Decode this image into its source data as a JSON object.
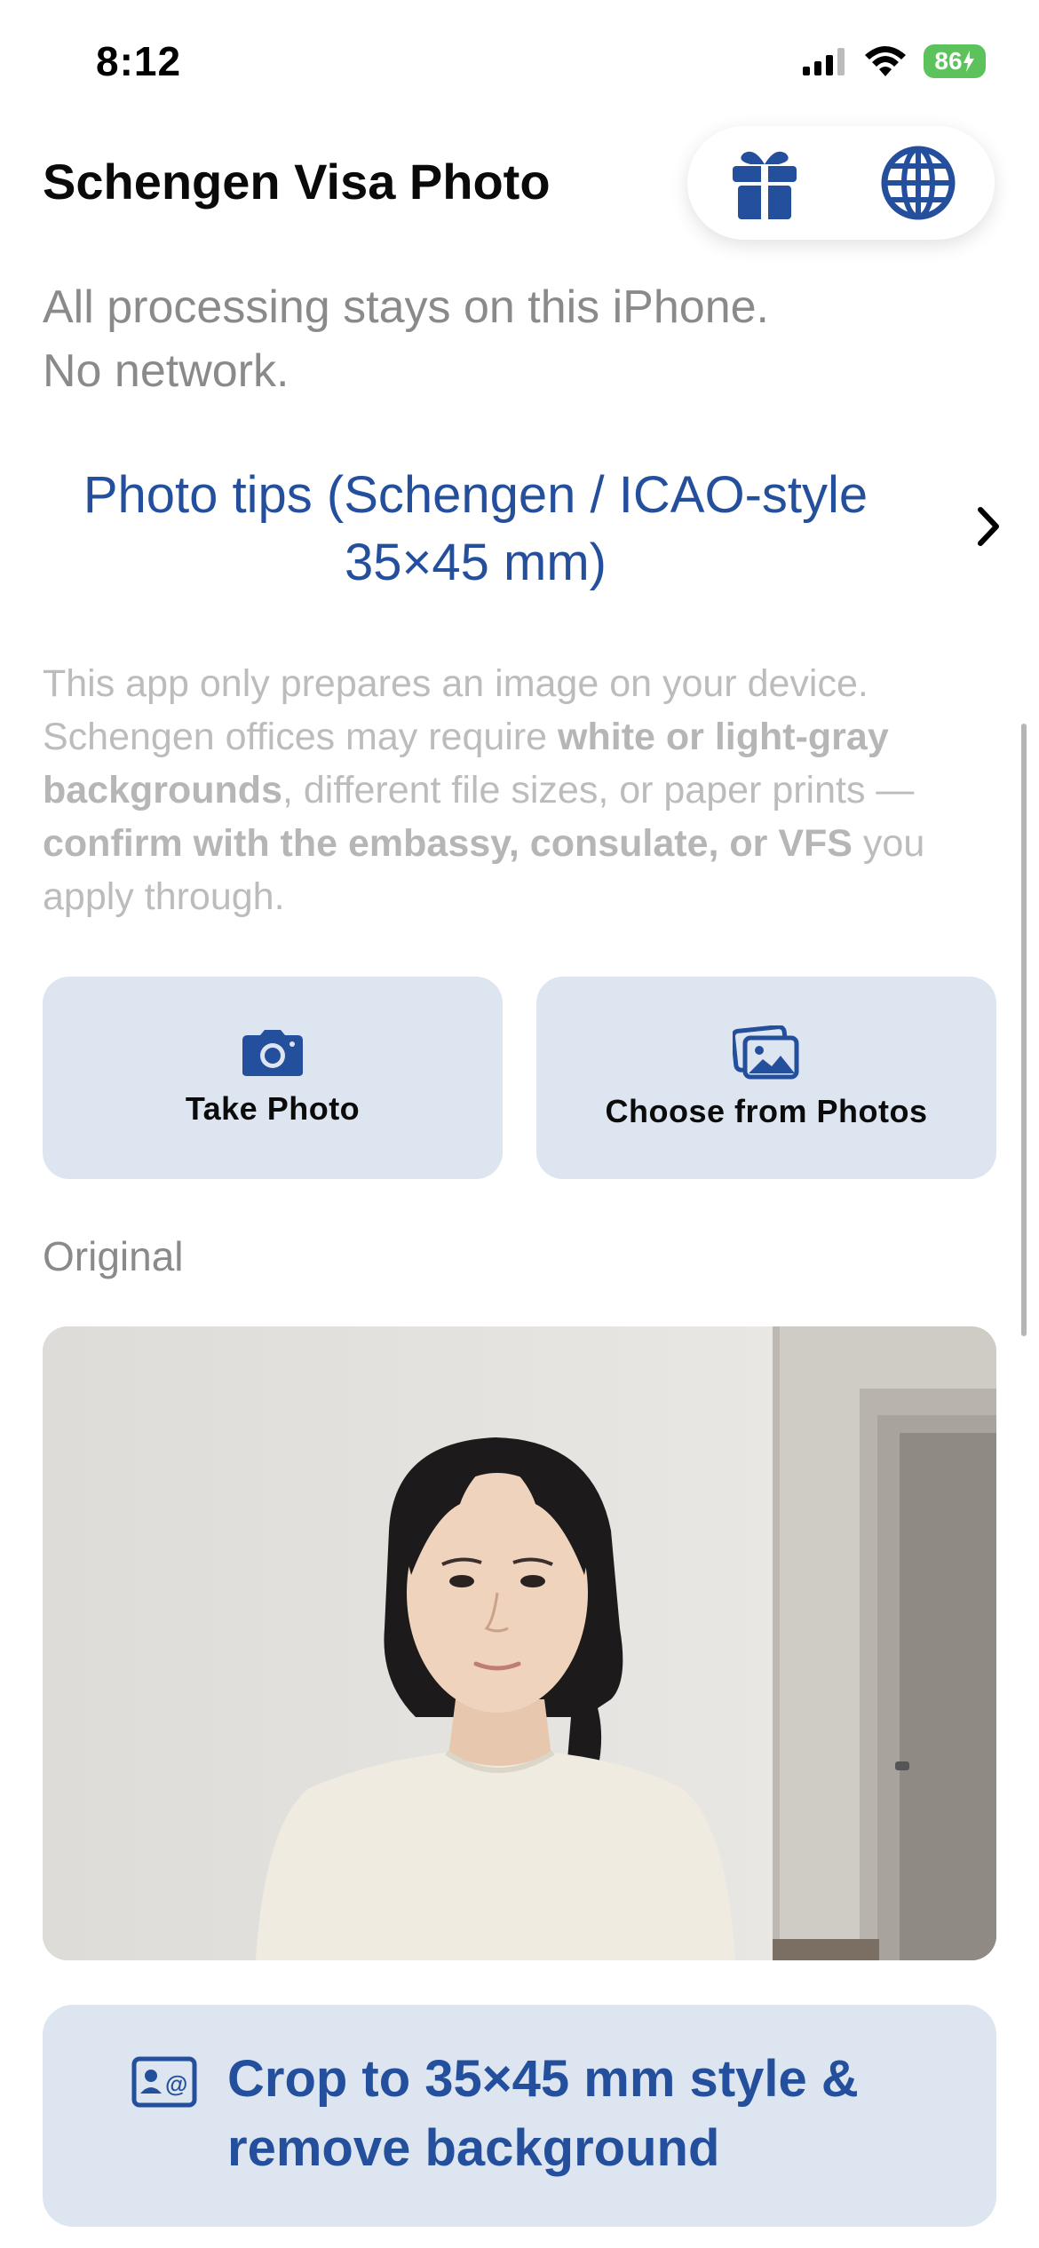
{
  "status_bar": {
    "time": "8:12",
    "battery": "86"
  },
  "header": {
    "title": "Schengen Visa Photo"
  },
  "icons": {
    "gift": "gift-icon",
    "globe": "globe-icon",
    "chevron": "chevron-right-icon",
    "camera": "camera-icon",
    "photos": "photo-library-icon",
    "crop": "id-card-icon"
  },
  "subtitle": {
    "line1": "All processing stays on this iPhone.",
    "line2": "No network."
  },
  "tips": {
    "line1": "Photo tips (Schengen / ICAO-style",
    "line2": "35×45 mm)"
  },
  "disclaimer": {
    "part1": "This app only prepares an image on your device. Schengen offices may require ",
    "bold1": "white or light-gray backgrounds",
    "part2": ", different file sizes, or paper prints — ",
    "bold2": "confirm with the embassy, consulate, or VFS",
    "part3": " you apply through."
  },
  "actions": {
    "take_photo": "Take Photo",
    "choose_photos": "Choose from Photos"
  },
  "original_label": "Original",
  "crop_button": {
    "line1": "Crop to 35×45 mm style &",
    "line2": "remove background"
  },
  "colors": {
    "accent": "#244f9c",
    "card_bg": "#dde5f0",
    "battery": "#5cc25c"
  }
}
